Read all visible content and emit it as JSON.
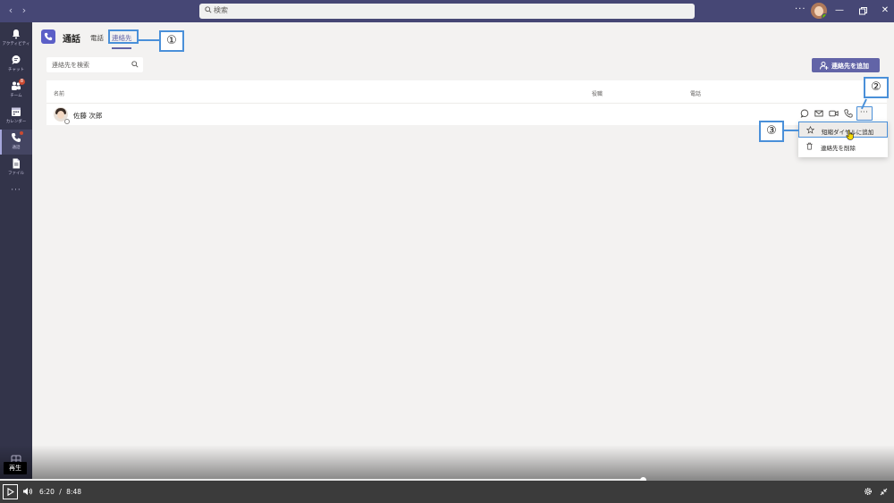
{
  "titlebar": {
    "search_placeholder": "検索",
    "more": "···",
    "back_arrow": "‹",
    "forward_arrow": "›",
    "minimize": "—",
    "close": "✕"
  },
  "rail": {
    "items": [
      {
        "label": "アクティビティ"
      },
      {
        "label": "チャット"
      },
      {
        "label": "チーム",
        "badge": "8"
      },
      {
        "label": "カレンダー"
      },
      {
        "label": "通話"
      },
      {
        "label": "ファイル"
      }
    ],
    "more": "···"
  },
  "header": {
    "title": "通話",
    "tabs": [
      {
        "label": "電話"
      },
      {
        "label": "連絡先"
      }
    ]
  },
  "contacts": {
    "search_placeholder": "連絡先を検索",
    "add_button": "連絡先を追加",
    "columns": [
      "名前",
      "役職",
      "電話"
    ],
    "rows": [
      {
        "name": "佐藤 次郎"
      }
    ],
    "more_button": "···"
  },
  "menu": {
    "items": [
      {
        "label": "短縮ダイヤルに追加"
      },
      {
        "label": "連絡先を削除"
      }
    ]
  },
  "callouts": {
    "one": "①",
    "two": "②",
    "three": "③"
  },
  "player": {
    "current_time": "6:20",
    "separator": "/",
    "total_time": "8:48",
    "progress": 0.7197,
    "tooltip": "再生"
  },
  "colors": {
    "titlebar": "#464775",
    "rail": "#33344a",
    "accent": "#6264a7",
    "callout_border": "#4a90d9"
  }
}
